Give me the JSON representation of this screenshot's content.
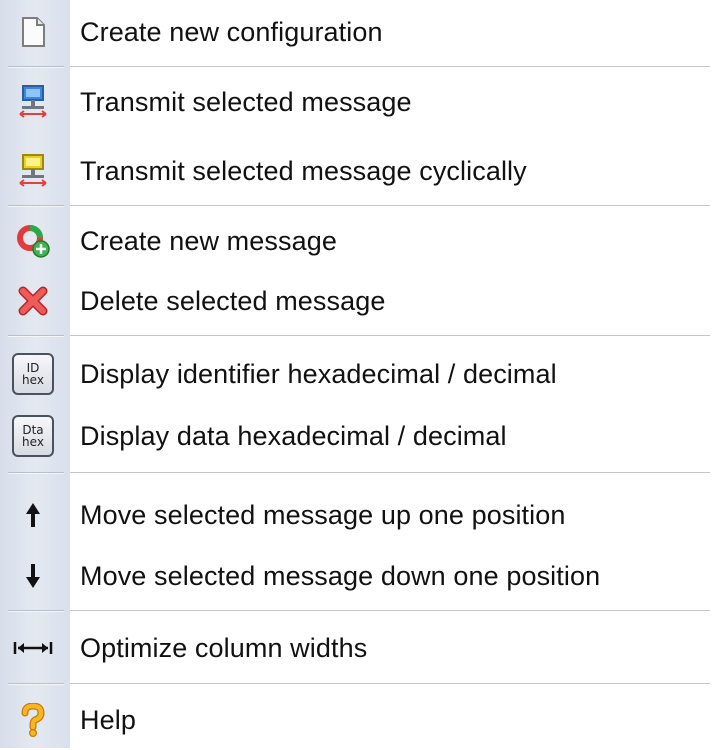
{
  "menu": {
    "items": [
      {
        "label": "Create new configuration",
        "icon": "new-document-icon"
      },
      {
        "label": "Transmit selected message",
        "icon": "transmit-network-icon"
      },
      {
        "label": "Transmit selected message cyclically",
        "icon": "transmit-cyclic-network-icon"
      },
      {
        "label": "Create new message",
        "icon": "create-message-icon"
      },
      {
        "label": "Delete selected message",
        "icon": "delete-red-x-icon"
      },
      {
        "label": "Display identifier hexadecimal / decimal",
        "icon": "id-hex-toggle-icon",
        "icon_text": [
          "ID",
          "hex"
        ]
      },
      {
        "label": "Display data hexadecimal / decimal",
        "icon": "data-hex-toggle-icon",
        "icon_text": [
          "Dta",
          "hex"
        ]
      },
      {
        "label": "Move selected message up one position",
        "icon": "arrow-up-icon"
      },
      {
        "label": "Move selected message down one position",
        "icon": "arrow-down-icon"
      },
      {
        "label": "Optimize column widths",
        "icon": "column-width-icon"
      },
      {
        "label": "Help",
        "icon": "help-question-icon"
      }
    ]
  },
  "colors": {
    "gutter": "#dfe4ee",
    "text": "#111111",
    "separator": "#c5c5c5",
    "delete_red": "#e23b3b",
    "help_orange": "#f4a81d"
  }
}
